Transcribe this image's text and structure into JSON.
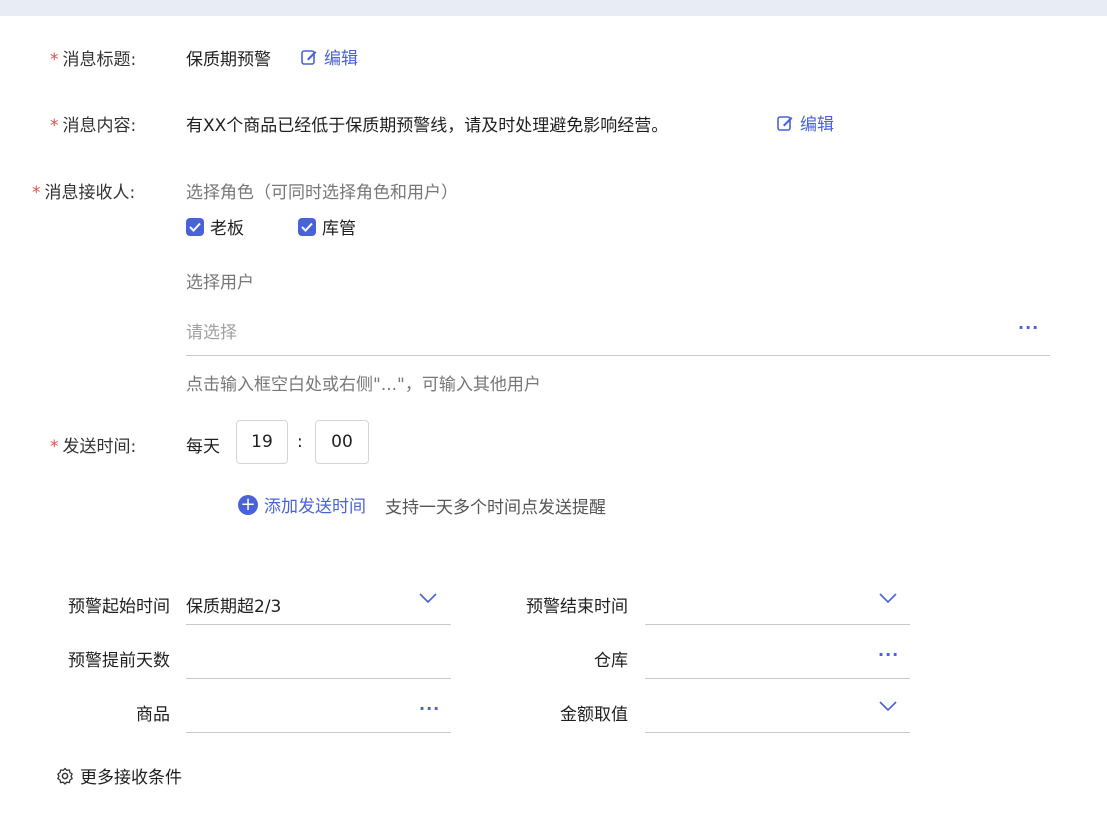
{
  "form": {
    "title": {
      "label": "消息标题:",
      "value": "保质期预警",
      "edit": "编辑"
    },
    "content": {
      "label": "消息内容:",
      "value": "有XX个商品已经低于保质期预警线，请及时处理避免影响经营。",
      "edit": "编辑"
    },
    "recipients": {
      "label": "消息接收人:",
      "roles_hint": "选择角色（可同时选择角色和用户）",
      "roles": [
        {
          "label": "老板",
          "checked": true
        },
        {
          "label": "库管",
          "checked": true
        }
      ],
      "users_label": "选择用户",
      "users_placeholder": "请选择",
      "users_help": "点击输入框空白处或右侧\"...\"，可输入其他用户"
    },
    "send_time": {
      "label": "发送时间:",
      "prefix": "每天",
      "hour": "19",
      "separator": ":",
      "minute": "00",
      "add_link": "添加发送时间",
      "add_hint": "支持一天多个时间点发送提醒"
    }
  },
  "conditions": {
    "start_time": {
      "label": "预警起始时间",
      "value": "保质期超2/3"
    },
    "end_time": {
      "label": "预警结束时间",
      "value": ""
    },
    "advance_days": {
      "label": "预警提前天数",
      "value": ""
    },
    "warehouse": {
      "label": "仓库",
      "value": ""
    },
    "product": {
      "label": "商品",
      "value": ""
    },
    "amount": {
      "label": "金额取值",
      "value": ""
    },
    "more": "更多接收条件"
  },
  "colors": {
    "accent": "#4a62d8",
    "required": "#e34d4d"
  },
  "icons": {
    "edit": "edit-icon",
    "more": "ellipsis-icon",
    "dropdown": "chevron-down-icon",
    "add": "plus-circle-icon",
    "settings": "gear-icon"
  }
}
